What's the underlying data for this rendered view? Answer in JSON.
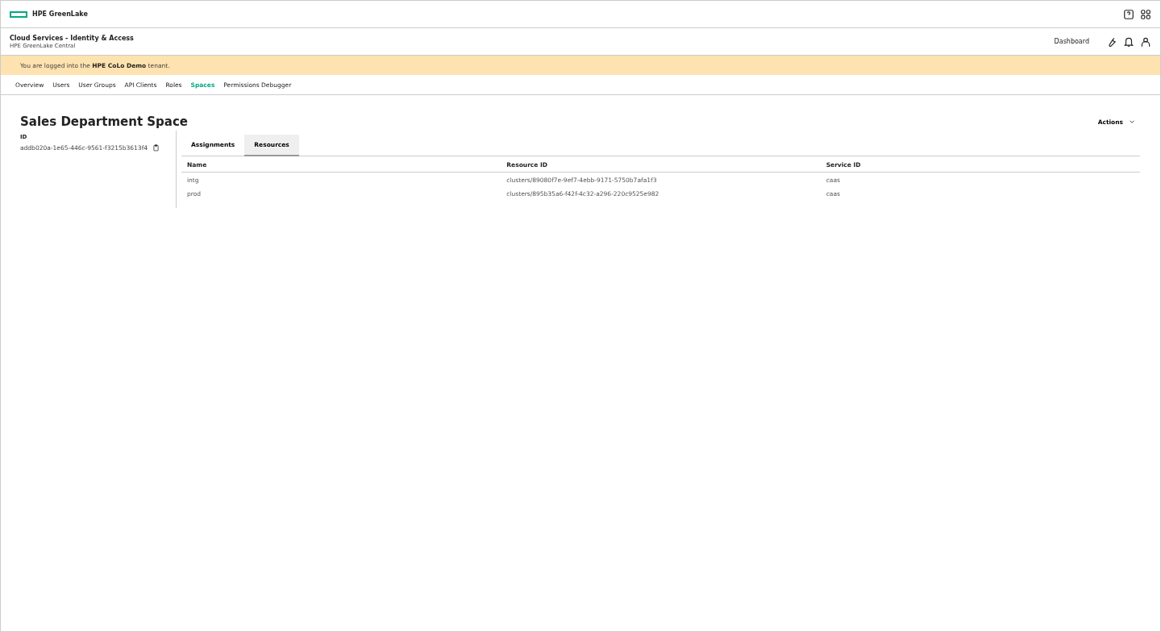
{
  "topbar": {
    "brand": "HPE GreenLake"
  },
  "header": {
    "title": "Cloud Services - Identity & Access",
    "subtitle": "HPE GreenLake Central",
    "link": "Dashboard"
  },
  "banner": {
    "text": "You are logged into the **HPE CoLo Demo** tenant."
  },
  "nav": [
    {
      "label": "Overview",
      "selected": false
    },
    {
      "label": "Users",
      "selected": false
    },
    {
      "label": "User Groups",
      "selected": false
    },
    {
      "label": "API Clients",
      "selected": false
    },
    {
      "label": "Roles",
      "selected": false
    },
    {
      "label": "Spaces",
      "selected": true
    },
    {
      "label": "Permissions Debugger",
      "selected": false
    }
  ],
  "page": {
    "title": "Sales Department Space",
    "actions": "Actions"
  },
  "details": {
    "label": "ID",
    "value": "addb020a-1e65-446c-9561-f3215b3613f4"
  },
  "tabs": [
    {
      "label": "Assignments",
      "selected": false
    },
    {
      "label": "Resources",
      "selected": true
    }
  ],
  "table": {
    "columns": [
      "Name",
      "Resource ID",
      "Service ID"
    ],
    "rows": [
      [
        "intg",
        "clusters/89080f7e-9ef7-4ebb-9171-5750b7afa1f3",
        "caas"
      ],
      [
        "prod",
        "clusters/895b35a6-f42f-4c32-a296-220c9525e982",
        "caas"
      ]
    ]
  }
}
